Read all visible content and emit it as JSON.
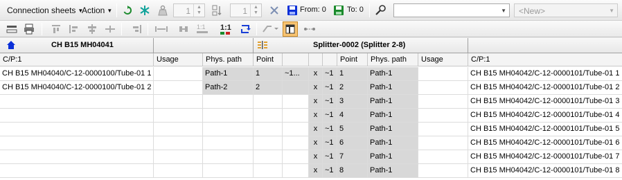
{
  "toolbar": {
    "connection_sheets_label": "Connection sheets",
    "action_label": "Action",
    "spin1_value": "1",
    "spin2_value": "1",
    "from_label": "From: 0",
    "to_label": "To: 0",
    "search_value": "",
    "new_placeholder": "<New>"
  },
  "left_header": {
    "title": "CH B15 MH04041"
  },
  "splitter_header": {
    "title": "Splitter-0002 (Splitter 2-8)"
  },
  "columns": {
    "left_cp": "C/P:1",
    "left_usage": "Usage",
    "left_phys": "Phys. path",
    "left_point": "Point",
    "right_point": "Point",
    "right_phys": "Phys. path",
    "right_usage": "Usage",
    "right_cp": "C/P:1"
  },
  "left_rows": [
    {
      "cp": "CH B15 MH04040/C-12-0000100/Tube-01 1",
      "phys": "Path-1",
      "point": "1",
      "extra": "~1..."
    },
    {
      "cp": "CH B15 MH04040/C-12-0000100/Tube-01 2",
      "phys": "Path-2",
      "point": "2",
      "extra": ""
    }
  ],
  "right_rows": [
    {
      "x": "x",
      "tilde": "~1",
      "point": "1",
      "phys": "Path-1",
      "cp": "CH B15 MH04042/C-12-0000101/Tube-01 1"
    },
    {
      "x": "x",
      "tilde": "~1",
      "point": "2",
      "phys": "Path-1",
      "cp": "CH B15 MH04042/C-12-0000101/Tube-01 2"
    },
    {
      "x": "x",
      "tilde": "~1",
      "point": "3",
      "phys": "Path-1",
      "cp": "CH B15 MH04042/C-12-0000101/Tube-01 3"
    },
    {
      "x": "x",
      "tilde": "~1",
      "point": "4",
      "phys": "Path-1",
      "cp": "CH B15 MH04042/C-12-0000101/Tube-01 4"
    },
    {
      "x": "x",
      "tilde": "~1",
      "point": "5",
      "phys": "Path-1",
      "cp": "CH B15 MH04042/C-12-0000101/Tube-01 5"
    },
    {
      "x": "x",
      "tilde": "~1",
      "point": "6",
      "phys": "Path-1",
      "cp": "CH B15 MH04042/C-12-0000101/Tube-01 6"
    },
    {
      "x": "x",
      "tilde": "~1",
      "point": "7",
      "phys": "Path-1",
      "cp": "CH B15 MH04042/C-12-0000101/Tube-01 7"
    },
    {
      "x": "x",
      "tilde": "~1",
      "point": "8",
      "phys": "Path-1",
      "cp": "CH B15 MH04042/C-12-0000101/Tube-01 8"
    }
  ],
  "icons": {
    "home": "home-icon",
    "splitter": "splitter-icon",
    "refresh": "refresh-icon",
    "snowflake": "snowflake-icon",
    "weight": "weight-icon",
    "clear": "clear-icon",
    "from": "from-save-icon",
    "to": "to-save-icon",
    "search": "search-icon"
  },
  "colors": {
    "accent_blue": "#0a2fd8",
    "green": "#1b8a2c",
    "grid_gray": "#d8d8d8"
  }
}
